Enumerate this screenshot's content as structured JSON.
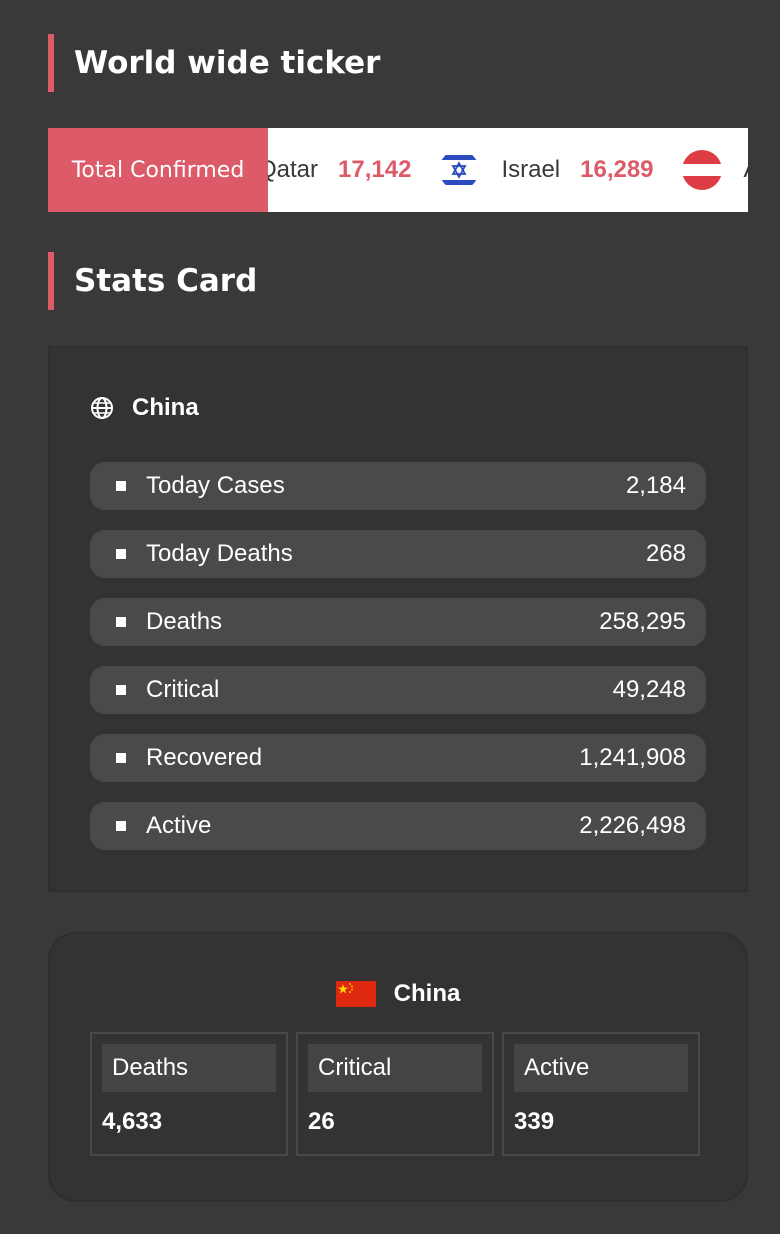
{
  "headings": {
    "ticker": "World wide ticker",
    "stats": "Stats Card"
  },
  "ticker": {
    "label": "Total Confirmed",
    "items": [
      {
        "country": "Qatar",
        "value": "17,142",
        "flag_icon": "none-visible"
      },
      {
        "country": "Israel",
        "value": "16,289",
        "flag_icon": "israel-flag-icon"
      },
      {
        "country": "A",
        "value": "",
        "flag_icon": "austria-flag-icon"
      }
    ]
  },
  "stats_card": {
    "country": "China",
    "icon": "globe-icon",
    "rows": [
      {
        "label": "Today Cases",
        "value": "2,184"
      },
      {
        "label": "Today Deaths",
        "value": "268"
      },
      {
        "label": "Deaths",
        "value": "258,295"
      },
      {
        "label": "Critical",
        "value": "49,248"
      },
      {
        "label": "Recovered",
        "value": "1,241,908"
      },
      {
        "label": "Active",
        "value": "2,226,498"
      }
    ]
  },
  "compact_card": {
    "country": "China",
    "flag_icon": "china-flag-icon",
    "boxes": [
      {
        "label": "Deaths",
        "value": "4,633"
      },
      {
        "label": "Critical",
        "value": "26"
      },
      {
        "label": "Active",
        "value": "339"
      }
    ]
  },
  "colors": {
    "background": "#3a3839",
    "card": "#333333",
    "row": "#4a4a4a",
    "accent": "#dd5a68"
  }
}
